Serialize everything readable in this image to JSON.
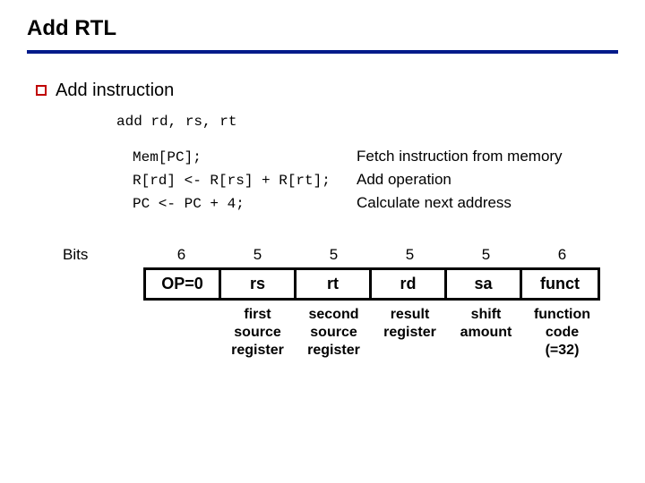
{
  "title": "Add RTL",
  "section_heading": "Add instruction",
  "syntax": "add rd, rs, rt",
  "rtl": [
    {
      "code": "Mem[PC];",
      "desc": "Fetch instruction from memory"
    },
    {
      "code": "R[rd] <- R[rs] + R[rt];",
      "desc": "Add operation"
    },
    {
      "code": "PC <- PC + 4;",
      "desc": "Calculate next address"
    }
  ],
  "bits_label": "Bits",
  "fields": [
    {
      "bits": "6",
      "name": "OP=0",
      "desc": ""
    },
    {
      "bits": "5",
      "name": "rs",
      "desc": "first\nsource\nregister"
    },
    {
      "bits": "5",
      "name": "rt",
      "desc": "second\nsource\nregister"
    },
    {
      "bits": "5",
      "name": "rd",
      "desc": "result\nregister"
    },
    {
      "bits": "5",
      "name": "sa",
      "desc": "shift\namount"
    },
    {
      "bits": "6",
      "name": "funct",
      "desc": "function\ncode\n(=32)"
    }
  ]
}
